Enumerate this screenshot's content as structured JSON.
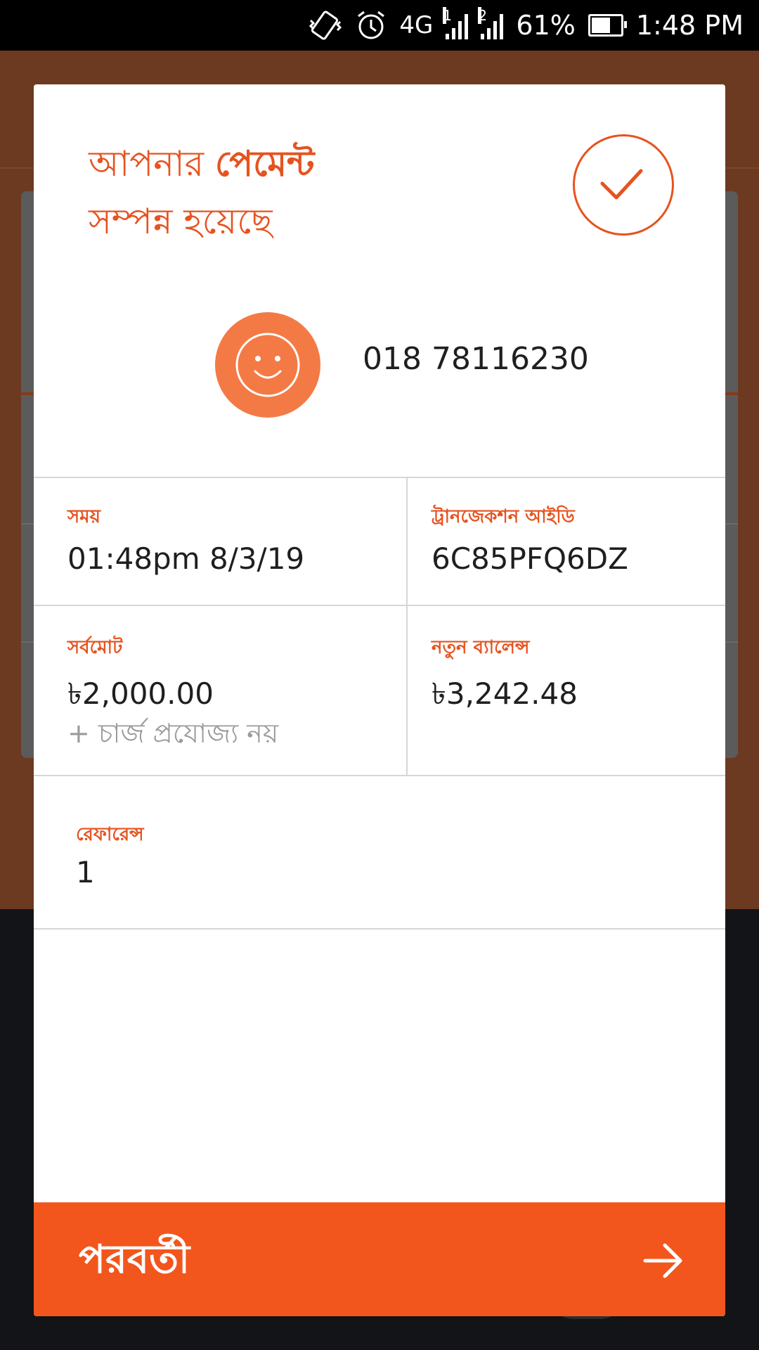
{
  "status_bar": {
    "network": "4G",
    "sim1": "1",
    "sim2": "2",
    "battery": "61%",
    "time": "1:48 PM"
  },
  "dialog": {
    "title_line1_normal": "আপনার ",
    "title_line1_bold": "পেমেন্ট",
    "title_line2": "সম্পন্ন হয়েছে",
    "recipient_number": "018 78116230",
    "details": {
      "time_label": "সময়",
      "time_value": "01:48pm 8/3/19",
      "txn_label": "ট্রানজেকশন আইডি",
      "txn_value": "6C85PFQ6DZ",
      "total_label": "সর্বমোট",
      "total_value": "৳2,000.00",
      "charge_note": "+ চার্জ প্রযোজ্য নয়",
      "balance_label": "নতুন ব্যালেন্স",
      "balance_value": "৳3,242.48",
      "reference_label": "রেফারেন্স",
      "reference_value": "1"
    },
    "next_button": "পরবর্তী"
  },
  "colors": {
    "accent": "#e6531f",
    "button": "#f2561d",
    "avatar": "#f47a45"
  }
}
